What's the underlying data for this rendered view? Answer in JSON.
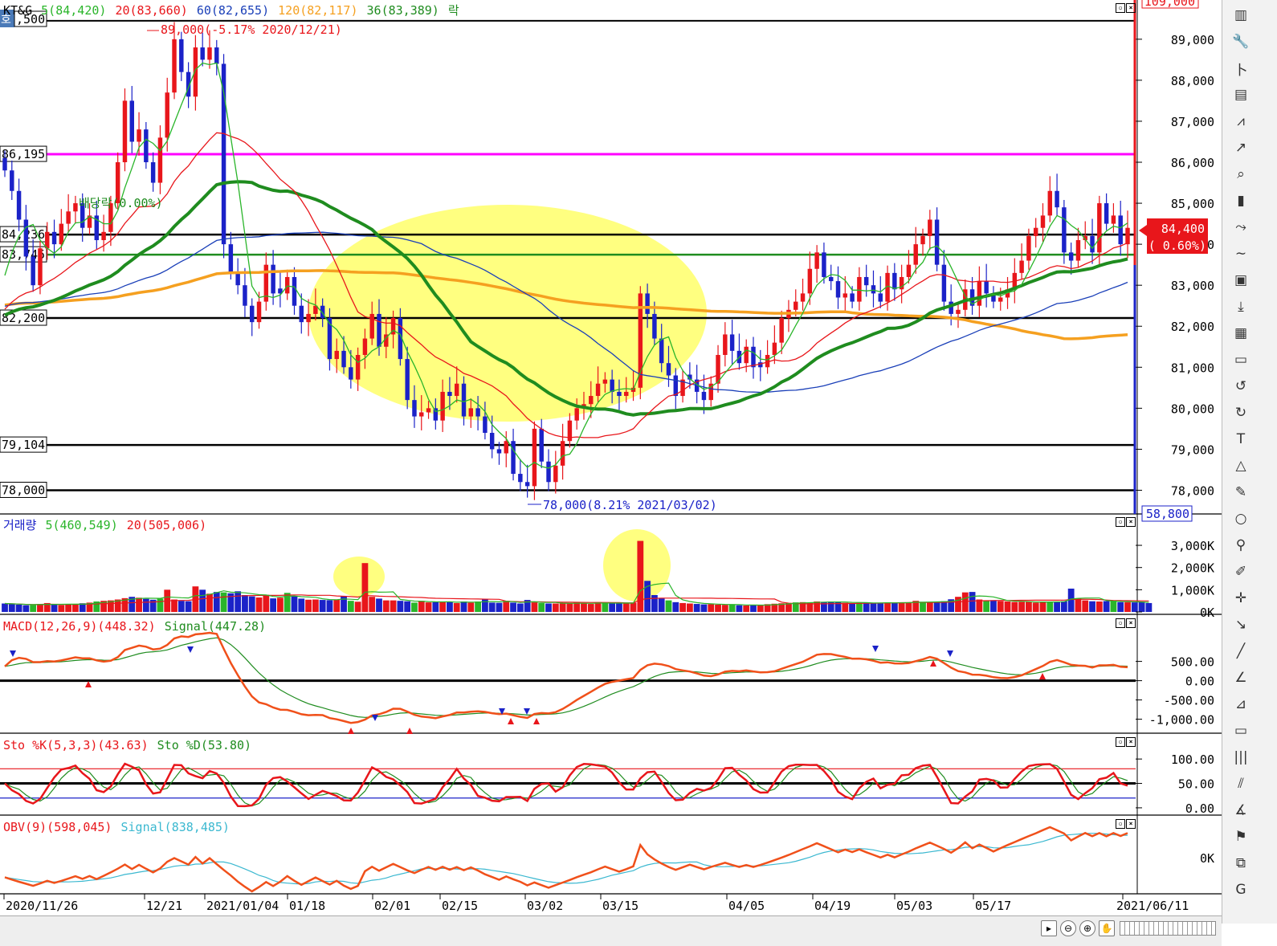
{
  "legend_price": {
    "stock": "KT&G",
    "ma5": "5(84,420)",
    "ma20": "20(83,660)",
    "ma60": "60(82,655)",
    "ma120": "120(82,117)",
    "ma36": "36(83,389)",
    "extra": "락"
  },
  "legend_volume": {
    "name": "거래량",
    "ma5": "5(460,549)",
    "ma20": "20(505,006)"
  },
  "legend_macd": {
    "name": "MACD(12,26,9)(448.32)",
    "signal": "Signal(447.28)"
  },
  "legend_sto": {
    "k": "Sto %K(5,3,3)(43.63)",
    "d": "Sto %D(53.80)"
  },
  "legend_obv": {
    "name": "OBV(9)(598,045)",
    "signal": "Signal(838,485)"
  },
  "annotations": {
    "high": "89,000(-5.17% 2020/12/21)",
    "low": "78,000(8.21% 2021/03/02)",
    "dividend": "배당락(0.00%)",
    "current_price": "84,400",
    "current_change": "( 0.60%)",
    "axis_top": "109,000",
    "axis_bottom": "58,800",
    "left_corner": "호",
    "left_corner_val": ",500"
  },
  "colors": {
    "up": "#e8161b",
    "down": "#1b22c8",
    "ma5": "#2ab52a",
    "ma20": "#e8161b",
    "ma60": "#1a3fb8",
    "ma120": "#f5a020",
    "ma36": "#1f8c1f",
    "magenta": "#ff00ff",
    "highlight": "#ffff55"
  },
  "chart_data": [
    {
      "type": "candlestick",
      "title": "KT&G",
      "ylim": [
        77500,
        89800
      ],
      "yticks": [
        78000,
        79000,
        80000,
        81000,
        82000,
        83000,
        84000,
        85000,
        86000,
        87000,
        88000,
        89000
      ],
      "ytick_labels": [
        "78,000",
        "79,000",
        "80,000",
        "81,000",
        "82,000",
        "83,000",
        "0",
        "85,000",
        "86,000",
        "87,000",
        "88,000",
        "89,000"
      ],
      "x_labels": [
        "2020/11/26",
        "12/21",
        "2021/01/04",
        "01/18",
        "02/01",
        "02/15",
        "03/02",
        "03/15",
        "04/05",
        "04/19",
        "05/03",
        "05/17",
        "2021/06/11"
      ],
      "horizontal_lines": [
        {
          "value": 86195,
          "label": "86,195",
          "color": "#ff00ff"
        },
        {
          "value": 84236,
          "label": "84,236",
          "color": "#000000"
        },
        {
          "value": 83745,
          "label": "83,745",
          "color": "#1f8c1f"
        },
        {
          "value": 82200,
          "label": "82,200",
          "color": "#000000"
        },
        {
          "value": 79104,
          "label": "79,104",
          "color": "#000000"
        },
        {
          "value": 78000,
          "label": "78,000",
          "color": "#000000"
        }
      ],
      "close": [
        85800,
        85300,
        84600,
        83700,
        83000,
        83900,
        84300,
        84000,
        84500,
        84800,
        85000,
        84400,
        84700,
        84100,
        84300,
        85000,
        86000,
        87500,
        86500,
        86800,
        86000,
        85500,
        86600,
        87700,
        89000,
        88200,
        87600,
        88800,
        88500,
        88800,
        88400,
        84000,
        83300,
        83000,
        82500,
        82100,
        82600,
        83500,
        82800,
        82800,
        83200,
        82500,
        82100,
        82300,
        82500,
        82200,
        81200,
        81400,
        81000,
        80700,
        81300,
        81700,
        82300,
        81500,
        81800,
        82200,
        81200,
        80200,
        79800,
        79900,
        80000,
        79700,
        80400,
        80300,
        80600,
        79800,
        80000,
        79800,
        79400,
        79000,
        78900,
        79200,
        78400,
        78200,
        78100,
        79500,
        78700,
        78200,
        78600,
        79200,
        79700,
        80000,
        80100,
        80300,
        80600,
        80700,
        80400,
        80300,
        80400,
        80500,
        82800,
        82300,
        81700,
        81100,
        80800,
        80300,
        80700,
        80700,
        80400,
        80200,
        80600,
        81300,
        81800,
        81400,
        81100,
        81500,
        81000,
        81000,
        81300,
        81600,
        82200,
        82400,
        82600,
        82800,
        83400,
        83800,
        83200,
        83100,
        82700,
        82800,
        82600,
        83200,
        83000,
        82800,
        82600,
        83300,
        82900,
        83200,
        83500,
        84000,
        84200,
        84600,
        83500,
        82600,
        82300,
        82400,
        82900,
        82500,
        83100,
        82800,
        82600,
        82700,
        82900,
        83300,
        83600,
        84200,
        84400,
        84700,
        85300,
        84900,
        83800,
        83600,
        84100,
        84200,
        83800,
        85000,
        84500,
        84700,
        84000,
        84400
      ],
      "volume": [
        380,
        350,
        330,
        300,
        310,
        360,
        400,
        330,
        310,
        340,
        360,
        390,
        420,
        470,
        500,
        520,
        560,
        620,
        680,
        640,
        590,
        550,
        600,
        1000,
        560,
        500,
        480,
        1150,
        1000,
        820,
        900,
        880,
        840,
        930,
        760,
        700,
        650,
        770,
        610,
        640,
        860,
        720,
        600,
        550,
        560,
        540,
        530,
        560,
        720,
        500,
        460,
        2200,
        680,
        600,
        520,
        520,
        500,
        480,
        420,
        500,
        430,
        440,
        470,
        450,
        400,
        470,
        420,
        470,
        560,
        420,
        410,
        500,
        420,
        380,
        540,
        430,
        400,
        380,
        380,
        390,
        390,
        420,
        380,
        360,
        440,
        420,
        390,
        380,
        380,
        420,
        3200,
        1400,
        760,
        610,
        520,
        440,
        400,
        380,
        360,
        340,
        350,
        330,
        320,
        340,
        300,
        290,
        300,
        310,
        350,
        370,
        390,
        400,
        430,
        440,
        420,
        470,
        440,
        470,
        450,
        410,
        390,
        410,
        430,
        390,
        400,
        430,
        400,
        430,
        420,
        500,
        430,
        440,
        470,
        480,
        570,
        680,
        880,
        900,
        560,
        510,
        530,
        490,
        470,
        450,
        460,
        450,
        420,
        470,
        450,
        470,
        480,
        1050,
        600,
        520,
        480,
        470,
        490,
        490,
        440,
        440,
        430,
        450,
        400
      ]
    },
    {
      "type": "line",
      "title": "MACD(12,26,9)",
      "ylim": [
        -1300,
        1200
      ],
      "yticks": [
        -1000,
        -500,
        0,
        500
      ],
      "ytick_labels": [
        "-1,000.00",
        "-500.00",
        "0.00",
        "500.00"
      ]
    },
    {
      "type": "line",
      "title": "Sto %K(5,3,3)",
      "ylim": [
        -10,
        120
      ],
      "yticks": [
        0,
        50,
        100
      ],
      "ytick_labels": [
        "0.00",
        "50.00",
        "100.00"
      ]
    },
    {
      "type": "line",
      "title": "OBV(9)",
      "ylim": [
        -6,
        6
      ],
      "yticks": [
        0
      ],
      "ytick_labels": [
        "0K"
      ]
    },
    {
      "type": "bar",
      "title": "거래량",
      "ylim": [
        0,
        3400
      ],
      "yticks": [
        0,
        1000,
        2000,
        3000
      ],
      "ytick_labels": [
        "0K",
        "1,000K",
        "2,000K",
        "3,000K"
      ]
    }
  ],
  "toolbar_icons": [
    "bar-chart-icon",
    "wrench-icon",
    "price-icon",
    "book-icon",
    "candles-icon",
    "auto-icon",
    "zoom-icon",
    "candle-icon",
    "line-chart-icon",
    "line-icon",
    "box-icon",
    "download-icon",
    "ratio-icon",
    "window-icon",
    "undo-icon",
    "redo-icon",
    "text-icon",
    "triangle-icon",
    "pencil-icon",
    "circle-icon",
    "magnifier-icon",
    "paint-icon",
    "cross-icon",
    "arrow-icon",
    "diagonal-icon",
    "angle-icon",
    "ruler-icon",
    "rectangle-icon",
    "grid-icon",
    "fan-icon",
    "angle2-icon",
    "flag-icon",
    "stack-icon",
    "g-icon"
  ]
}
